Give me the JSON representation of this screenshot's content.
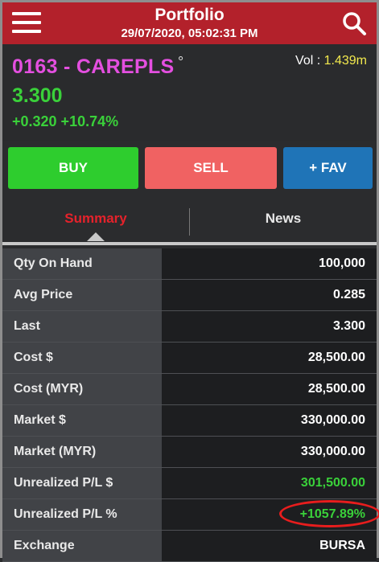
{
  "header": {
    "title": "Portfolio",
    "datetime": "29/07/2020, 05:02:31 PM",
    "menu_icon": "hamburger-icon",
    "search_icon": "search-icon"
  },
  "stock": {
    "name": "0163 - CAREPLS",
    "degree": "°",
    "vol_label": "Vol : ",
    "vol_value": "1.439m",
    "price": "3.300",
    "change": "+0.320 +10.74%",
    "colors": {
      "name": "#e44fe0",
      "up": "#3ad13a",
      "vol": "#f2e94d"
    }
  },
  "actions": {
    "buy": "BUY",
    "sell": "SELL",
    "fav": "+ FAV",
    "colors": {
      "buy": "#2ecd2e",
      "sell": "#f06262",
      "fav": "#1f74b7"
    }
  },
  "tabs": {
    "summary": "Summary",
    "news": "News",
    "active": "Summary"
  },
  "rows": [
    {
      "label": "Qty On Hand",
      "value": "100,000"
    },
    {
      "label": "Avg Price",
      "value": "0.285"
    },
    {
      "label": "Last",
      "value": "3.300"
    },
    {
      "label": "Cost $",
      "value": "28,500.00"
    },
    {
      "label": "Cost (MYR)",
      "value": "28,500.00"
    },
    {
      "label": "Market $",
      "value": "330,000.00"
    },
    {
      "label": "Market (MYR)",
      "value": "330,000.00"
    },
    {
      "label": "Unrealized P/L $",
      "value": "301,500.00"
    },
    {
      "label": "Unrealized P/L %",
      "value": "+1057.89%"
    },
    {
      "label": "Exchange",
      "value": "BURSA"
    }
  ]
}
